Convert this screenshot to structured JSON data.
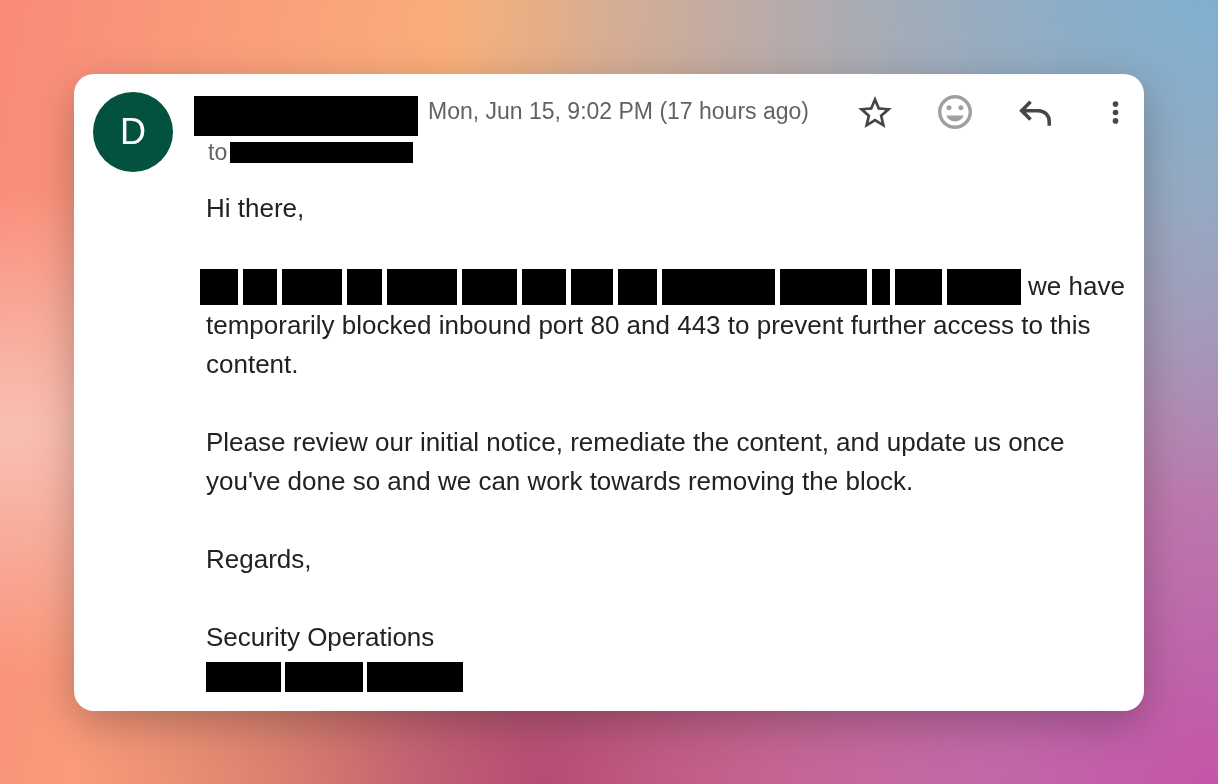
{
  "message": {
    "avatar": "D",
    "sender": {
      "redacted": true
    },
    "date": "Mon, Jun 15, 9:02 PM (17 hours ago)",
    "starred": false,
    "recipient": {
      "label": "to",
      "redacted": true
    },
    "body": [
      {
        "kind": "text",
        "text": "Hi there,"
      },
      {
        "kind": "redacted_lead",
        "lead": "we have",
        "text": "temporarily blocked inbound port 80 and 443 to prevent further access to this content."
      },
      {
        "kind": "text",
        "text": "Please review our initial notice, remediate the content, and update us once you've done so and we can work towards removing the block."
      },
      {
        "kind": "text",
        "text": "Regards,"
      },
      {
        "kind": "signature",
        "text": "Security Operations"
      }
    ]
  }
}
